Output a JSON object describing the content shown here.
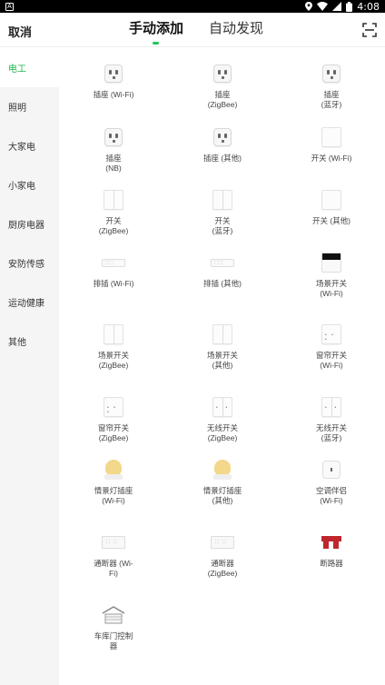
{
  "status_bar": {
    "time": "4:08",
    "app_icon": "A"
  },
  "header": {
    "cancel_label": "取消",
    "tabs": [
      {
        "label": "手动添加",
        "active": true
      },
      {
        "label": "自动发现",
        "active": false
      }
    ],
    "scan_icon": "scan-icon"
  },
  "sidebar": {
    "items": [
      {
        "label": "电工",
        "active": true
      },
      {
        "label": "照明"
      },
      {
        "label": "大家电"
      },
      {
        "label": "小家电"
      },
      {
        "label": "厨房电器"
      },
      {
        "label": "安防传感"
      },
      {
        "label": "运动健康"
      },
      {
        "label": "其他"
      }
    ]
  },
  "devices": [
    {
      "label": "插座 (Wi-Fi)",
      "icon": "socket-icon"
    },
    {
      "label": "插座\n(ZigBee)",
      "icon": "socket-icon"
    },
    {
      "label": "插座\n(蓝牙)",
      "icon": "socket-icon"
    },
    {
      "label": "插座\n(NB)",
      "icon": "socket-icon"
    },
    {
      "label": "插座 (其他)",
      "icon": "socket-icon"
    },
    {
      "label": "开关 (Wi-Fi)",
      "icon": "switch-icon"
    },
    {
      "label": "开关\n(ZigBee)",
      "icon": "switch-icon"
    },
    {
      "label": "开关\n(蓝牙)",
      "icon": "switch-icon"
    },
    {
      "label": "开关 (其他)",
      "icon": "switch-icon"
    },
    {
      "label": "排插 (Wi-Fi)",
      "icon": "power-strip-icon"
    },
    {
      "label": "排插 (其他)",
      "icon": "power-strip-icon"
    },
    {
      "label": "场景开关\n(Wi-Fi)",
      "icon": "scene-panel-icon"
    },
    {
      "label": "场景开关\n(ZigBee)",
      "icon": "switch-icon"
    },
    {
      "label": "场景开关\n(其他)",
      "icon": "switch-icon"
    },
    {
      "label": "窗帘开关\n(Wi-Fi)",
      "icon": "curtain-switch-icon"
    },
    {
      "label": "窗帘开关\n(ZigBee)",
      "icon": "curtain-switch-icon"
    },
    {
      "label": "无线开关\n(ZigBee)",
      "icon": "wireless-switch-icon"
    },
    {
      "label": "无线开关\n(蓝牙)",
      "icon": "wireless-switch-icon"
    },
    {
      "label": "情景灯插座\n(Wi-Fi)",
      "icon": "lamp-icon"
    },
    {
      "label": "情景灯插座\n(其他)",
      "icon": "lamp-icon"
    },
    {
      "label": "空调伴侣\n(Wi-Fi)",
      "icon": "ac-companion-icon"
    },
    {
      "label": "通断器 (Wi-\nFi)",
      "icon": "relay-icon"
    },
    {
      "label": "通断器\n(ZigBee)",
      "icon": "relay-icon"
    },
    {
      "label": "断路器",
      "icon": "circuit-breaker-icon"
    },
    {
      "label": "车库门控制\n器",
      "icon": "garage-icon"
    }
  ],
  "colors": {
    "accent": "#22b54a",
    "sidebar_bg": "#f5f5f5"
  }
}
